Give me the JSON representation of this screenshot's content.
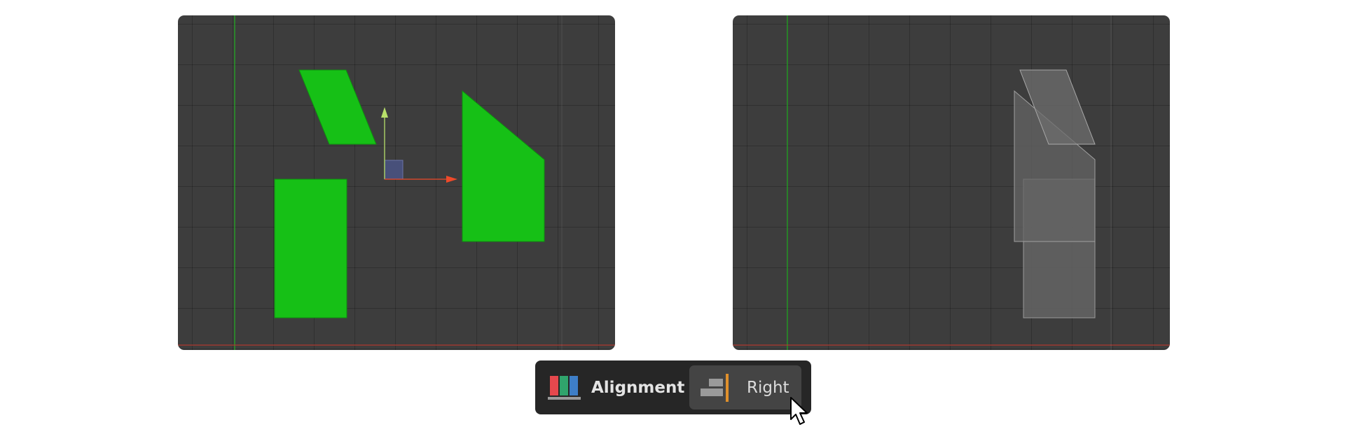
{
  "toolbar": {
    "label": "Alignment",
    "icon": "alignment-panels-icon",
    "align_button": {
      "label": "Right",
      "icon": "align-right-icon",
      "state": "hovered"
    }
  },
  "viewports": {
    "left": {
      "state": "before-alignment",
      "selection": "selected"
    },
    "right": {
      "state": "after-right-alignment",
      "selection": "ghosted"
    }
  },
  "colors": {
    "viewport_background": "#3d3d3d",
    "selected_shape_fill": "#16c016",
    "ghost_shape_fill": "#5a5a5a",
    "y_axis": "#2fb52f",
    "x_axis": "#c0392b",
    "gizmo_x": "#ef4a2a",
    "gizmo_y": "#b8e06a",
    "toolbar_background": "#262626",
    "button_background": "#444444",
    "align_bar": "#e0902b",
    "icon_red": "#e5484d",
    "icon_green": "#30a46c",
    "icon_blue": "#3e7ec7"
  }
}
